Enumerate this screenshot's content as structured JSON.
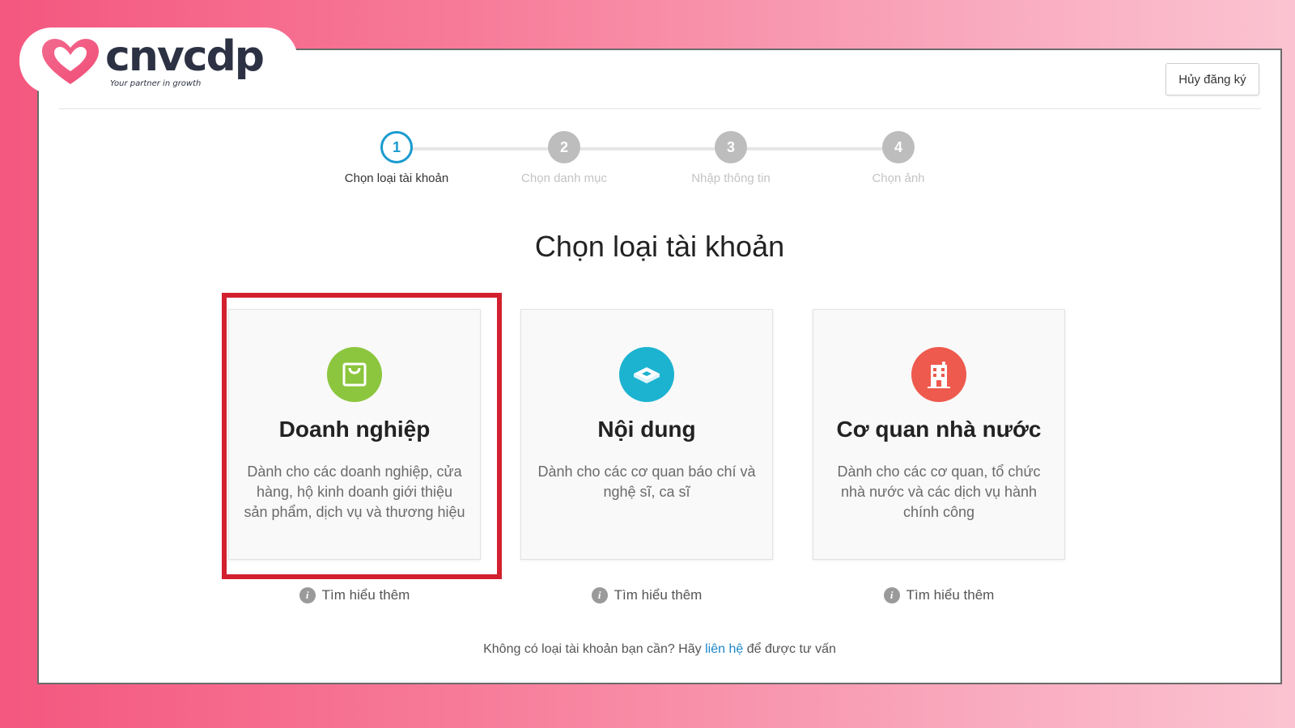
{
  "logo": {
    "text": "cnvcdp",
    "tagline": "Your partner in growth"
  },
  "header": {
    "cancel_label": "Hủy đăng ký"
  },
  "stepper": {
    "steps": [
      {
        "number": "1",
        "label": "Chọn loại tài khoản",
        "active": true
      },
      {
        "number": "2",
        "label": "Chọn danh mục",
        "active": false
      },
      {
        "number": "3",
        "label": "Nhập thông tin",
        "active": false
      },
      {
        "number": "4",
        "label": "Chọn ảnh",
        "active": false
      }
    ]
  },
  "main": {
    "title": "Chọn loại tài khoản",
    "cards": [
      {
        "title": "Doanh nghiệp",
        "description": "Dành cho các doanh nghiệp, cửa hàng, hộ kinh doanh giới thiệu sản phẩm, dịch vụ và thương hiệu",
        "icon": "shopping-bag-icon",
        "icon_color": "#8cc63e",
        "learn_more": "Tìm hiểu thêm"
      },
      {
        "title": "Nội dung",
        "description": "Dành cho các cơ quan báo chí và nghệ sĩ, ca sĩ",
        "icon": "content-icon",
        "icon_color": "#1cb3d1",
        "learn_more": "Tìm hiểu thêm"
      },
      {
        "title": "Cơ quan nhà nước",
        "description": "Dành cho các cơ quan, tổ chức nhà nước và các dịch vụ hành chính công",
        "icon": "building-icon",
        "icon_color": "#ee5a4e",
        "learn_more": "Tìm hiểu thêm"
      }
    ],
    "selected_card": "Doanh nghiệp"
  },
  "footer": {
    "prefix": "Không có loại tài khoản bạn cần? Hãy",
    "link": "liên hệ",
    "suffix": "để được tư vấn"
  },
  "colors": {
    "accent": "#1a9bcf",
    "highlight": "#d3202f",
    "link": "#1a86c8"
  }
}
